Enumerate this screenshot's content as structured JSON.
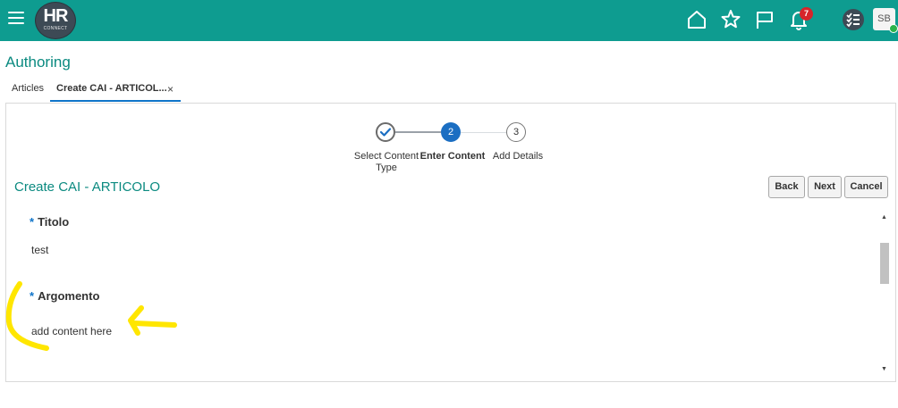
{
  "header": {
    "logo_text": "HR",
    "logo_subtext": "CONNECT",
    "notifications_count": "7",
    "user_initials": "SB",
    "icons": [
      "menu-icon",
      "home-icon",
      "star-icon",
      "flag-icon",
      "bell-icon",
      "checklist-icon"
    ],
    "brand_color": "#0e9c90"
  },
  "page": {
    "title": "Authoring"
  },
  "tabs": [
    {
      "label": "Articles"
    },
    {
      "label": "Create CAI - ARTICOL..."
    }
  ],
  "close_glyph": "×",
  "train": {
    "steps": [
      {
        "number": "1",
        "label": "Select Content Type",
        "state": "completed"
      },
      {
        "number": "2",
        "label": "Enter Content",
        "state": "current"
      },
      {
        "number": "3",
        "label": "Add Details",
        "state": "pending"
      }
    ]
  },
  "form": {
    "title": "Create CAI - ARTICOLO",
    "buttons": {
      "back": "Back",
      "next": "Next",
      "cancel": "Cancel"
    },
    "fields": [
      {
        "label": "Titolo",
        "required_mark": "*",
        "value": "test"
      },
      {
        "label": "Argomento",
        "required_mark": "*",
        "value": "add content here"
      }
    ]
  },
  "annotation": {
    "color": "#ffe600"
  }
}
